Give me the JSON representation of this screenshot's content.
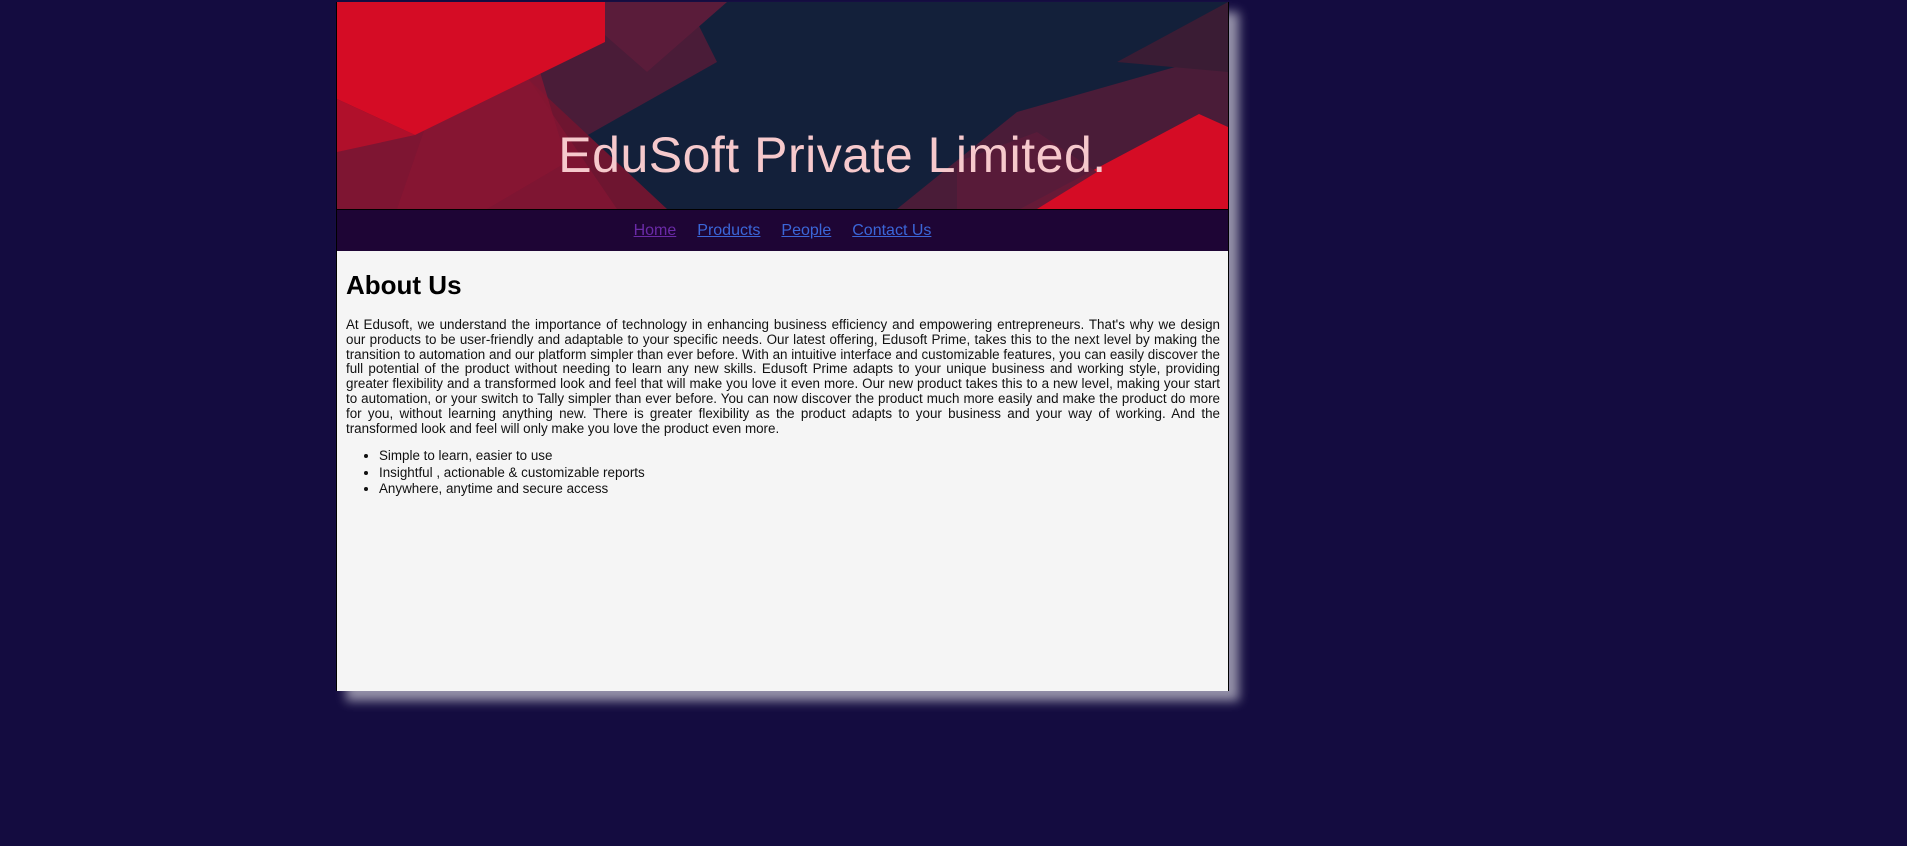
{
  "header": {
    "title": "EduSoft Private Limited."
  },
  "nav": {
    "items": [
      {
        "label": "Home",
        "visited": true
      },
      {
        "label": "Products",
        "visited": false
      },
      {
        "label": "People",
        "visited": false
      },
      {
        "label": "Contact Us",
        "visited": false
      }
    ]
  },
  "main": {
    "heading": "About Us",
    "paragraph": "At Edusoft, we understand the importance of technology in enhancing business efficiency and empowering entrepreneurs. That's why we design our products to be user-friendly and adaptable to your specific needs. Our latest offering, Edusoft Prime, takes this to the next level by making the transition to automation and our platform simpler than ever before. With an intuitive interface and customizable features, you can easily discover the full potential of the product without needing to learn any new skills. Edusoft Prime adapts to your unique business and working style, providing greater flexibility and a transformed look and feel that will make you love it even more. Our new product takes this to a new level, making your start to automation, or your switch to Tally simpler than ever before. You can now discover the product much more easily and make the product do more for you, without learning anything new. There is greater flexibility as the product adapts to your business and your way of working. And the transformed look and feel will only make you love the product even more.",
    "features": [
      "Simple to learn, easier to use",
      "Insightful , actionable & customizable reports",
      "Anywhere, anytime and secure access"
    ]
  },
  "colors": {
    "background": "#140c40",
    "banner_dark": "#13203a",
    "banner_red": "#d50c25",
    "nav_bg": "#1e0535",
    "link": "#3b66d8",
    "link_visited": "#6a2aa6"
  }
}
